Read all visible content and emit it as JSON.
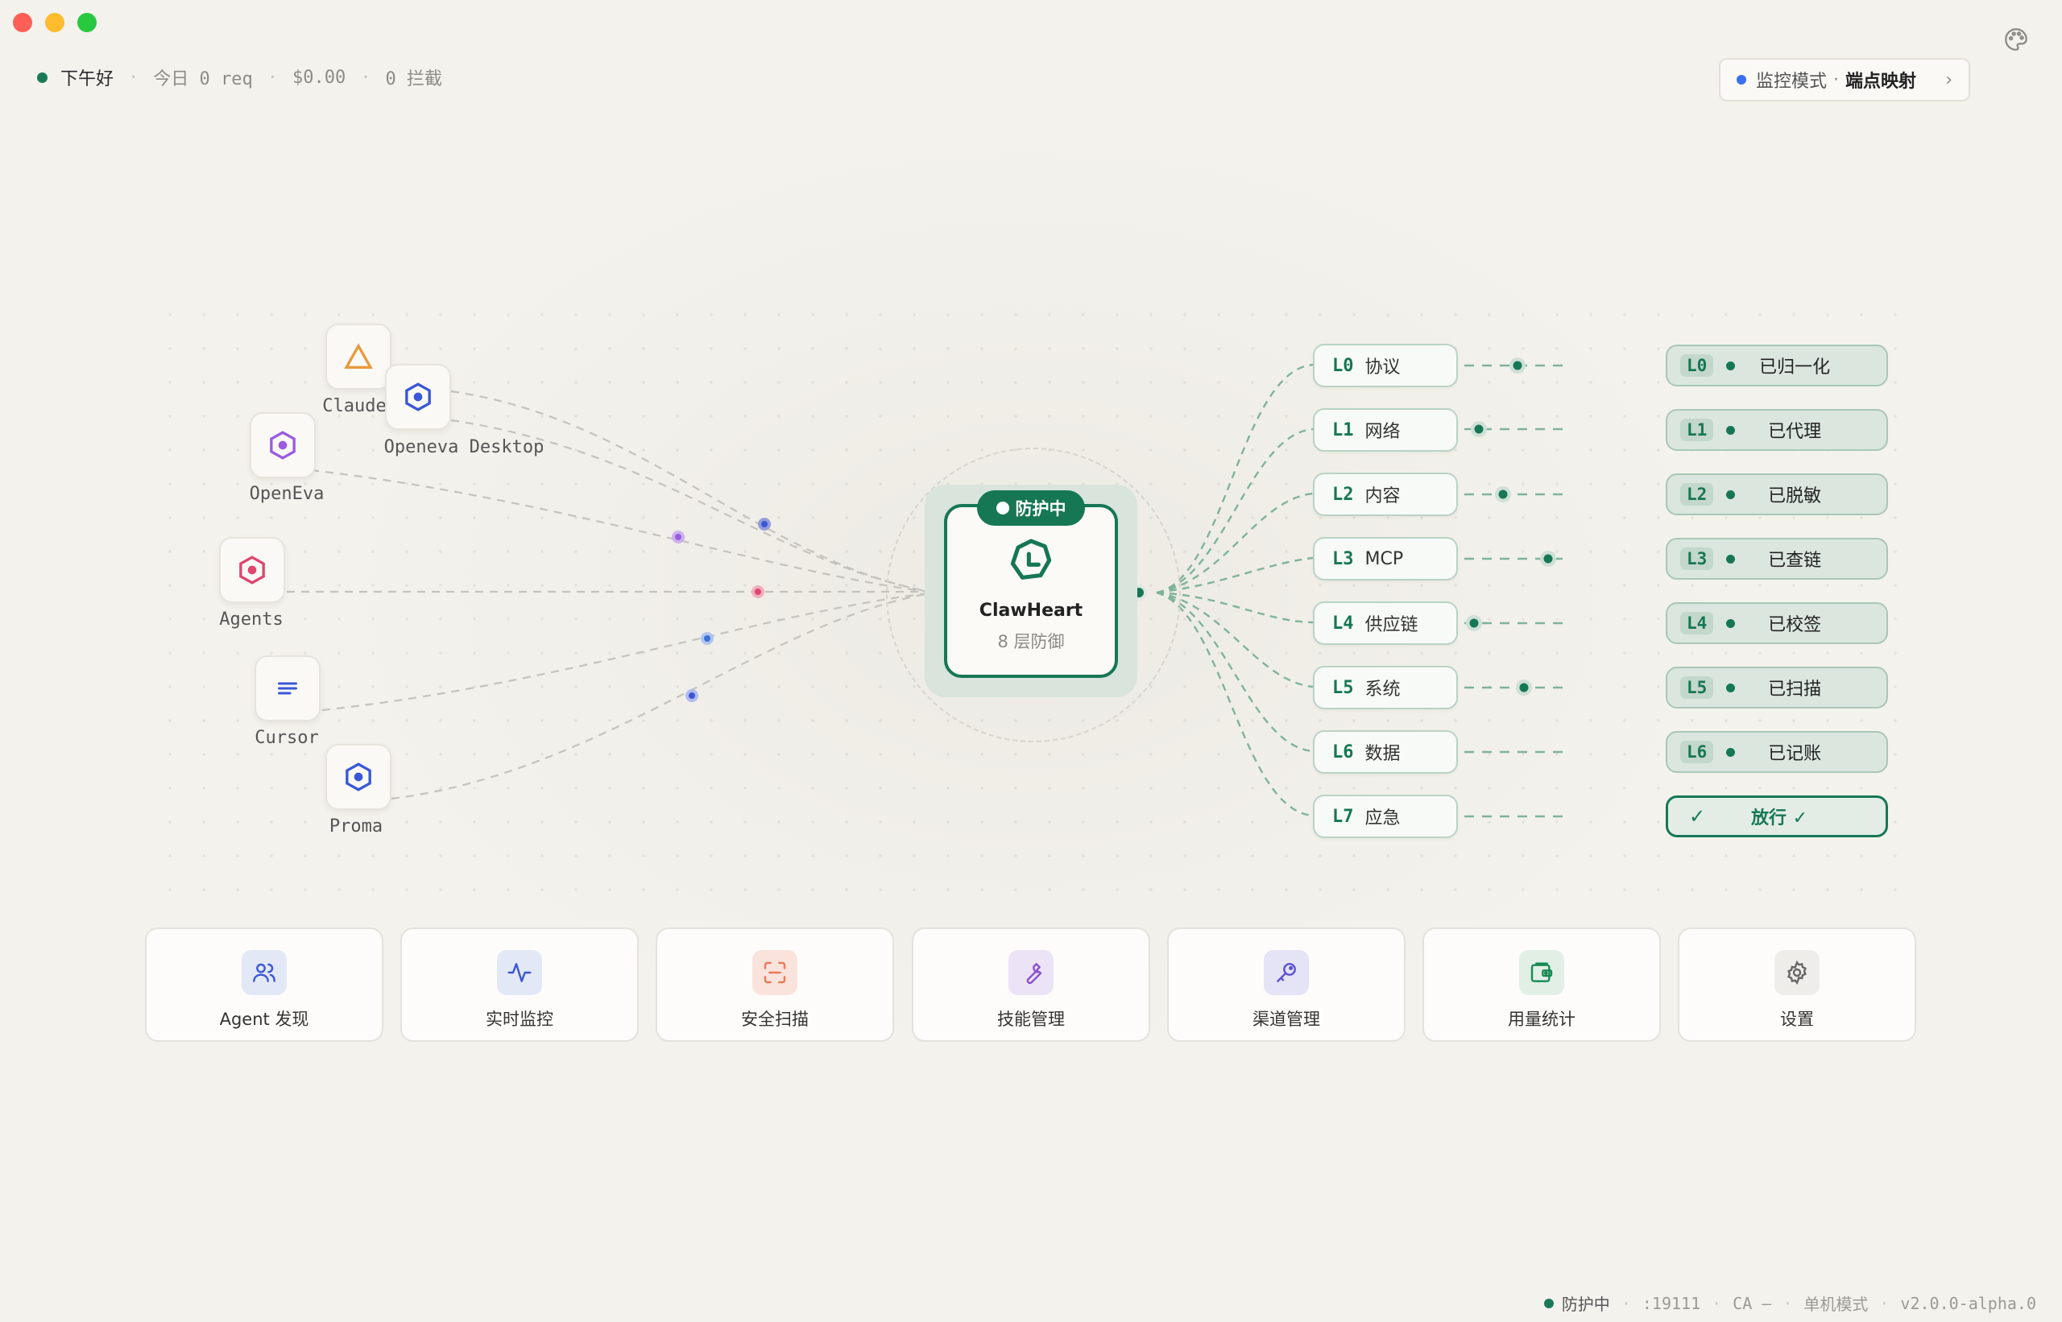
{
  "window": {
    "traffic_lights": [
      "close",
      "minimize",
      "zoom"
    ]
  },
  "status": {
    "greeting": "下午好",
    "today": "今日 0 req",
    "cost": "$0.00",
    "blocked": "0 拦截"
  },
  "mode": {
    "label": "监控模式",
    "value": "端点映射",
    "chevron": "›"
  },
  "agents": [
    {
      "name": "Claude",
      "icon": "triangle-icon",
      "color": "#e89a3c"
    },
    {
      "name": "Openeva Desktop",
      "icon": "hexagon-icon",
      "color": "#3a56d8"
    },
    {
      "name": "OpenEva",
      "icon": "hexagon-icon",
      "color": "#9a5be0"
    },
    {
      "name": "Agents",
      "icon": "hexagon-icon",
      "color": "#e0456e"
    },
    {
      "name": "Cursor",
      "icon": "lines-icon",
      "color": "#3a56d8"
    },
    {
      "name": "Proma",
      "icon": "hexagon-icon",
      "color": "#3a56d8"
    }
  ],
  "hub": {
    "badge": "防护中",
    "title": "ClawHeart",
    "subtitle": "8 层防御"
  },
  "layers": [
    {
      "code": "L0",
      "name": "协议"
    },
    {
      "code": "L1",
      "name": "网络"
    },
    {
      "code": "L2",
      "name": "内容"
    },
    {
      "code": "L3",
      "name": "MCP"
    },
    {
      "code": "L4",
      "name": "供应链"
    },
    {
      "code": "L5",
      "name": "系统"
    },
    {
      "code": "L6",
      "name": "数据"
    },
    {
      "code": "L7",
      "name": "应急"
    }
  ],
  "results": [
    {
      "code": "L0",
      "text": "已归一化"
    },
    {
      "code": "L1",
      "text": "已代理"
    },
    {
      "code": "L2",
      "text": "已脱敏"
    },
    {
      "code": "L3",
      "text": "已查链"
    },
    {
      "code": "L4",
      "text": "已校签"
    },
    {
      "code": "L5",
      "text": "已扫描"
    },
    {
      "code": "L6",
      "text": "已记账"
    }
  ],
  "final_result": {
    "check": "✓",
    "text": "放行 ✓"
  },
  "nav": [
    {
      "label": "Agent 发现",
      "icon": "users-icon",
      "bg": "#e3e8f7",
      "color": "#3a56d8"
    },
    {
      "label": "实时监控",
      "icon": "activity-icon",
      "bg": "#e3e8f7",
      "color": "#3a56d8"
    },
    {
      "label": "安全扫描",
      "icon": "scan-icon",
      "bg": "#f9e3dc",
      "color": "#e87a55"
    },
    {
      "label": "技能管理",
      "icon": "wrench-icon",
      "bg": "#ece3f6",
      "color": "#8a4fd2"
    },
    {
      "label": "渠道管理",
      "icon": "key-icon",
      "bg": "#e5e3f6",
      "color": "#5a4fd2"
    },
    {
      "label": "用量统计",
      "icon": "wallet-icon",
      "bg": "#e1efe5",
      "color": "#1a8a55"
    },
    {
      "label": "设置",
      "icon": "gear-icon",
      "bg": "#eeedea",
      "color": "#666"
    }
  ],
  "footer": {
    "status": "防护中",
    "port": ":19111",
    "ca": "CA —",
    "mode": "单机模式",
    "version": "v2.0.0-alpha.0"
  },
  "colors": {
    "accent": "#167755",
    "background": "#f3f1ec"
  }
}
